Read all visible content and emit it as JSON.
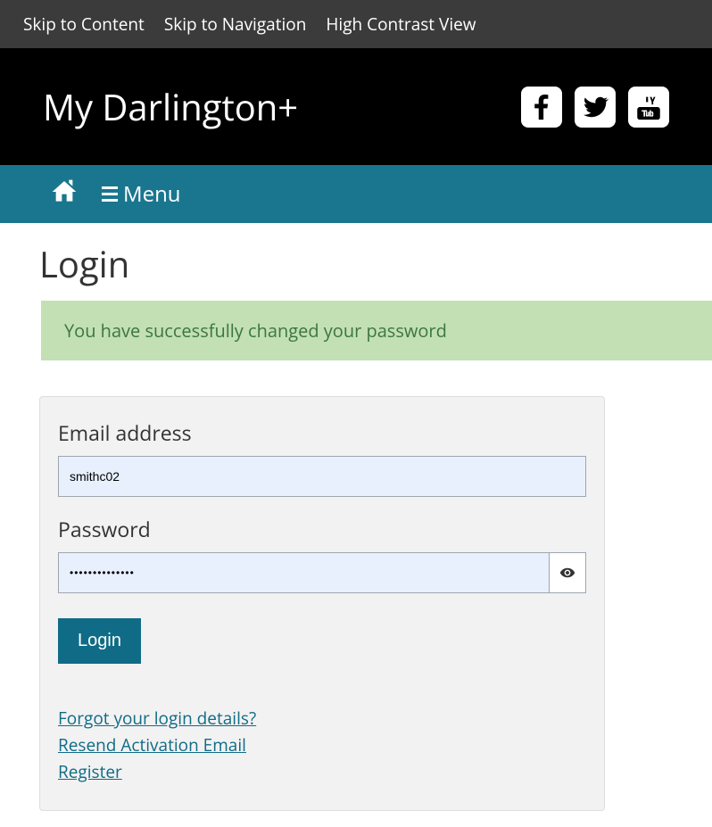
{
  "topBar": {
    "skipContent": "Skip to Content",
    "skipNav": "Skip to Navigation",
    "highContrast": "High Contrast View"
  },
  "header": {
    "siteTitle": "My Darlington+"
  },
  "nav": {
    "menuLabel": "Menu"
  },
  "page": {
    "title": "Login"
  },
  "alert": {
    "message": "You have successfully changed your password"
  },
  "form": {
    "emailLabel": "Email address",
    "emailValue": "smithc02",
    "passwordLabel": "Password",
    "passwordValue": "••••••••••••••",
    "loginButton": "Login"
  },
  "links": {
    "forgot": "Forgot your login details?",
    "resend": "Resend Activation Email",
    "register": "Register"
  }
}
